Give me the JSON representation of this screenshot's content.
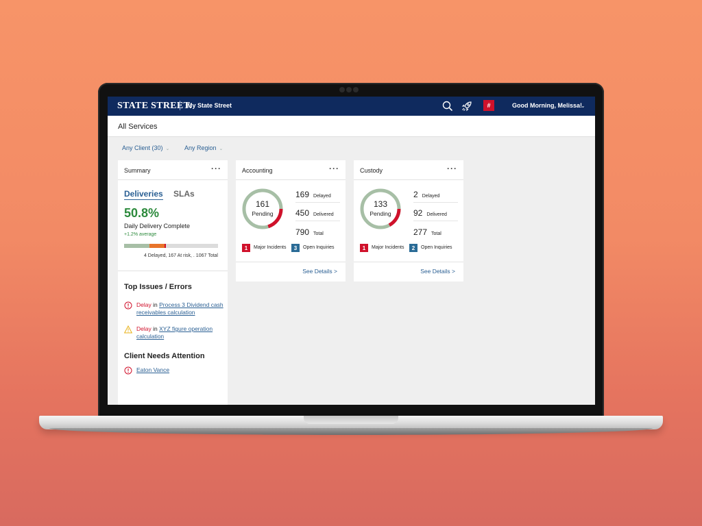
{
  "header": {
    "brand": "STATE STREET.",
    "app_name": "My State Street",
    "notif_badge": "#",
    "greeting": "Good Morning, Melissa!"
  },
  "page_title": "All Services",
  "filters": [
    {
      "label": "Any Client (30)"
    },
    {
      "label": "Any Region"
    }
  ],
  "summary": {
    "title": "Summary",
    "tabs": [
      "Deliveries",
      "SLAs"
    ],
    "percent": "50.8%",
    "percent_label": "Daily Delivery Complete",
    "average": "+1.2% average",
    "progress": {
      "segments": [
        {
          "fraction": 0.27,
          "color": "#a7bfa6"
        },
        {
          "fraction": 0.16,
          "color": "#e8742a"
        },
        {
          "fraction": 0.015,
          "color": "#d0112b"
        }
      ]
    },
    "progress_legend": "4 Delayed, 167 At risk, . 1067 Total",
    "issues_title": "Top Issues / Errors",
    "issues": [
      {
        "status": "Delay",
        "joiner": "in",
        "link": "Process 3 Dividend cash receivables calculation",
        "severity": "error"
      },
      {
        "status": "Delay",
        "joiner": "in",
        "link": "XYZ figure operation calculation",
        "severity": "warning"
      }
    ],
    "clients_title": "Client Needs Attention",
    "clients": [
      {
        "name": "Eaton Vance"
      }
    ]
  },
  "cards": [
    {
      "title": "Accounting",
      "pending_value": "161",
      "pending_label": "Pending",
      "ring_progress": 0.2,
      "stats": [
        {
          "value": "169",
          "label": "Delayed"
        },
        {
          "value": "450",
          "label": "Delivered"
        },
        {
          "value": "790",
          "label": "Total"
        }
      ],
      "incidents": {
        "count": "1",
        "label": "Major Incidents"
      },
      "inquiries": {
        "count": "3",
        "label": "Open Inquiries"
      },
      "link": "See Details >"
    },
    {
      "title": "Custody",
      "pending_value": "133",
      "pending_label": "Pending",
      "ring_progress": 0.17,
      "stats": [
        {
          "value": "2",
          "label": "Delayed"
        },
        {
          "value": "92",
          "label": "Delivered"
        },
        {
          "value": "277",
          "label": "Total"
        }
      ],
      "incidents": {
        "count": "1",
        "label": "Major Incidents"
      },
      "inquiries": {
        "count": "2",
        "label": "Open Inquiries"
      },
      "link": "See Details >"
    }
  ],
  "colors": {
    "navy": "#0f2a5e",
    "red": "#d0112b",
    "link_blue": "#2a5f93",
    "green": "#2c8a3c",
    "ring_gray": "#a7bfa6"
  },
  "icons": [
    "search-icon",
    "rocket-icon",
    "chevron-down-icon",
    "error-icon",
    "warning-icon",
    "more-icon"
  ]
}
